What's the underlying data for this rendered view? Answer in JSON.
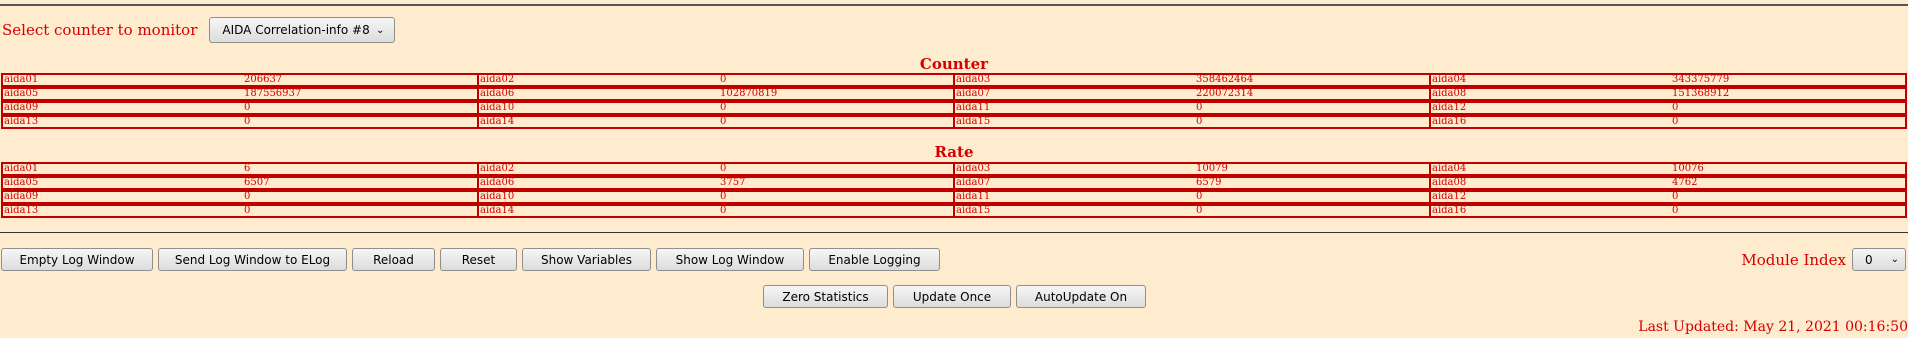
{
  "selector": {
    "label": "Select counter to monitor",
    "selected": "AIDA Correlation-info #8"
  },
  "counter": {
    "title": "Counter",
    "rows": [
      [
        {
          "name": "aida01",
          "value": "206637"
        },
        {
          "name": "aida02",
          "value": "0"
        },
        {
          "name": "aida03",
          "value": "358462464"
        },
        {
          "name": "aida04",
          "value": "343375779"
        }
      ],
      [
        {
          "name": "aida05",
          "value": "187556937"
        },
        {
          "name": "aida06",
          "value": "102870819"
        },
        {
          "name": "aida07",
          "value": "220072314"
        },
        {
          "name": "aida08",
          "value": "151368912"
        }
      ],
      [
        {
          "name": "aida09",
          "value": "0"
        },
        {
          "name": "aida10",
          "value": "0"
        },
        {
          "name": "aida11",
          "value": "0"
        },
        {
          "name": "aida12",
          "value": "0"
        }
      ],
      [
        {
          "name": "aida13",
          "value": "0"
        },
        {
          "name": "aida14",
          "value": "0"
        },
        {
          "name": "aida15",
          "value": "0"
        },
        {
          "name": "aida16",
          "value": "0"
        }
      ]
    ]
  },
  "rate": {
    "title": "Rate",
    "rows": [
      [
        {
          "name": "aida01",
          "value": "6"
        },
        {
          "name": "aida02",
          "value": "0"
        },
        {
          "name": "aida03",
          "value": "10079"
        },
        {
          "name": "aida04",
          "value": "10076"
        }
      ],
      [
        {
          "name": "aida05",
          "value": "6507"
        },
        {
          "name": "aida06",
          "value": "3757"
        },
        {
          "name": "aida07",
          "value": "6579"
        },
        {
          "name": "aida08",
          "value": "4762"
        }
      ],
      [
        {
          "name": "aida09",
          "value": "0"
        },
        {
          "name": "aida10",
          "value": "0"
        },
        {
          "name": "aida11",
          "value": "0"
        },
        {
          "name": "aida12",
          "value": "0"
        }
      ],
      [
        {
          "name": "aida13",
          "value": "0"
        },
        {
          "name": "aida14",
          "value": "0"
        },
        {
          "name": "aida15",
          "value": "0"
        },
        {
          "name": "aida16",
          "value": "0"
        }
      ]
    ]
  },
  "buttons": {
    "empty_log": "Empty Log Window",
    "send_log": "Send Log Window to ELog",
    "reload": "Reload",
    "reset": "Reset",
    "show_variables": "Show Variables",
    "show_log": "Show Log Window",
    "enable_logging": "Enable Logging",
    "zero_stats": "Zero Statistics",
    "update_once": "Update Once",
    "autoupdate": "AutoUpdate On"
  },
  "module": {
    "label": "Module Index",
    "selected": "0"
  },
  "last_updated": "Last Updated: May 21, 2021 00:16:50",
  "colors": {
    "background": "#ffebcd",
    "text": "#d40000",
    "border": "#c00000"
  }
}
